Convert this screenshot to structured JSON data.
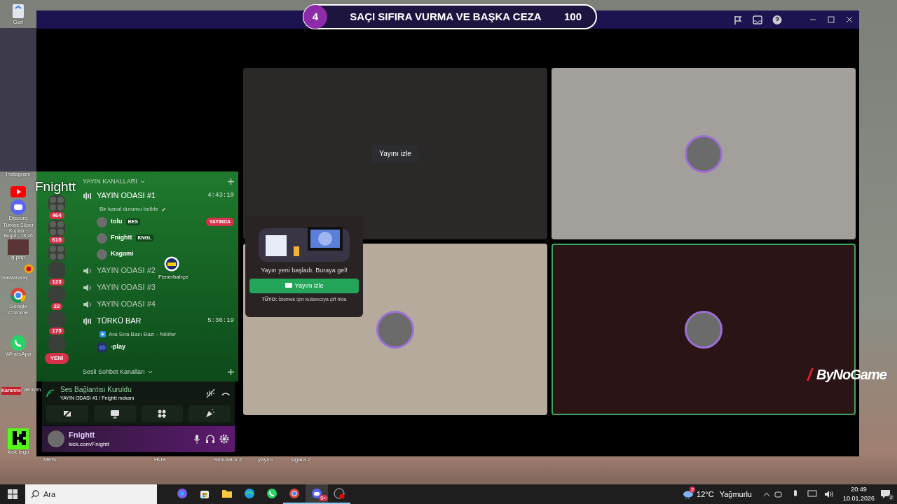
{
  "banner": {
    "number": "4",
    "text": "SAÇI SIFIRA VURMA VE BAŞKA CEZA",
    "score": "100"
  },
  "streamer_name": "Fnightt",
  "desktop_icons": [
    {
      "kind": "recycle",
      "label": "Geri"
    },
    {
      "kind": "none",
      "label": "Instagram"
    },
    {
      "kind": "youtube"
    },
    {
      "kind": "discord",
      "label": "Discord"
    },
    {
      "kind": "photo",
      "label": "g.php"
    },
    {
      "kind": "chrome",
      "label": "Google Chrome"
    },
    {
      "kind": "whatsapp",
      "label": "WhatsApp"
    },
    {
      "kind": "kick",
      "label": "kick logo"
    }
  ],
  "desktop_bottom_labels": [
    "MEN",
    "HUB",
    "Simulator 2",
    "yayını",
    "sigara 2"
  ],
  "match": {
    "text": "Türkiye Süper Kupası · Bugün, 18:46",
    "team_left": "Galatasaray",
    "team_right": "Fenerbahçe"
  },
  "chat_line": {
    "user": "Karanne",
    "message": ": deniyim"
  },
  "stream_tiles": [
    {
      "kind": "preview",
      "color": "#2b2828",
      "speaking": false,
      "button": "Yayını izle"
    },
    {
      "kind": "avatar",
      "color": "#a3a09b",
      "speaking": false
    },
    {
      "kind": "avatar",
      "color": "#b5aa9c",
      "speaking": false
    },
    {
      "kind": "avatar",
      "color": "#2a1416",
      "speaking": true
    }
  ],
  "popup": {
    "message": "Yayın yeni başladı. Buraya gel!",
    "button": "Yayını izle",
    "tip": "**TÜYO:** İzlemek için kullanıcıya çift tıkla"
  },
  "sponsor_logo": "ByNoGame",
  "servers": [
    {
      "kind": "folder",
      "badge": "464"
    },
    {
      "kind": "folder",
      "badge": "615"
    },
    {
      "kind": "folder"
    },
    {
      "kind": "server",
      "badge": "123"
    },
    {
      "kind": "server",
      "badge": "22"
    },
    {
      "kind": "server",
      "badge": "175"
    },
    {
      "kind": "server"
    }
  ],
  "new_badge": "YENİ",
  "category": "YAYIN KANALLARI",
  "channels": [
    {
      "name": "YAYIN ODASI #1",
      "active": true,
      "timer": "4:43:10",
      "status": "Bir kanal durumu belirle",
      "members": [
        {
          "name": "tolu",
          "tag": "BES",
          "live": "YAYINDA"
        },
        {
          "name": "Fnightt",
          "tag": "KNGL"
        },
        {
          "name": "Kagami"
        }
      ]
    },
    {
      "name": "YAYIN ODASI #2",
      "active": false
    },
    {
      "name": "YAYIN ODASI #3",
      "active": false
    },
    {
      "name": "YAYIN ODASI #4",
      "active": false
    },
    {
      "name": "TÜRKÜ BAR",
      "active": true,
      "timer": "5:36:19",
      "activity": "Ara Sıra Bazı Bazı - Nilüfer",
      "members": [
        {
          "name": "-play",
          "bot": true
        }
      ]
    }
  ],
  "category_2": "Sesli Sohbet Kanalları",
  "voice_panel": {
    "status": "Ses Bağlantısı Kuruldu",
    "channel": "YAYIN ODASI #1 / Fnightt mekanı"
  },
  "user_panel": {
    "name": "Fnightt",
    "status": "kick.com/Fnightt"
  },
  "taskbar": {
    "search_placeholder": "Ara",
    "apps": [
      {
        "kind": "copilot",
        "running": false,
        "selected": false
      },
      {
        "kind": "store",
        "running": false,
        "selected": false
      },
      {
        "kind": "folder",
        "running": false,
        "selected": false
      },
      {
        "kind": "edge",
        "running": false,
        "selected": false
      },
      {
        "kind": "whatsapp",
        "running": false,
        "selected": false
      },
      {
        "kind": "chrome",
        "running": true,
        "selected": false
      },
      {
        "kind": "discord",
        "running": true,
        "selected": true,
        "badge": "9+"
      },
      {
        "kind": "obs",
        "running": true,
        "selected": false
      }
    ],
    "weather_temp": "12°C",
    "weather_text": "Yağmurlu",
    "weather_badge": "2",
    "time": "20:49",
    "date": "10.01.2026",
    "notifications": "2"
  }
}
